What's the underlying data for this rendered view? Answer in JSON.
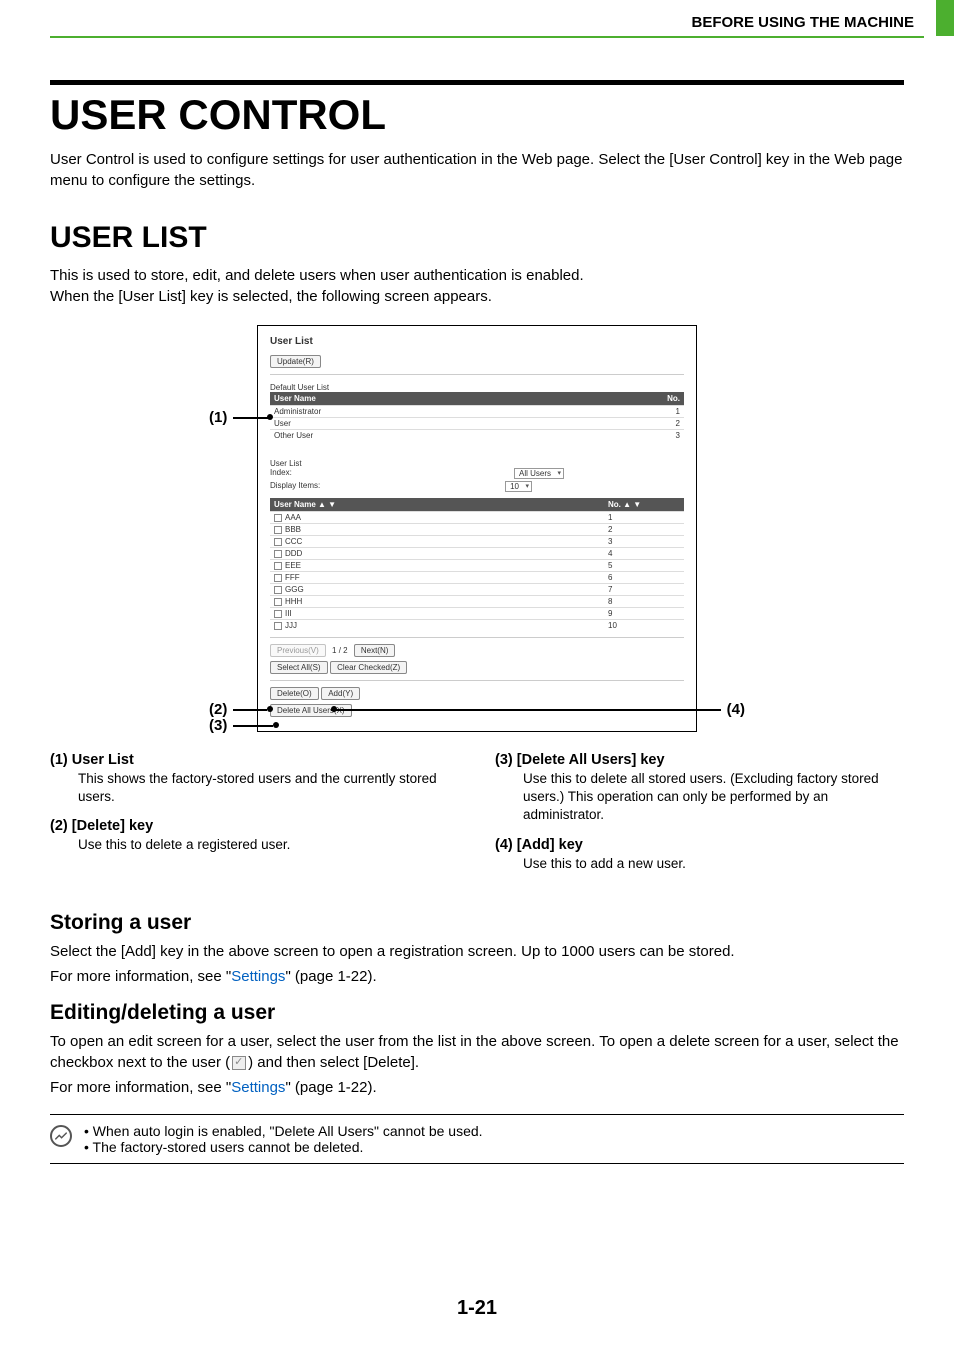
{
  "breadcrumb": "BEFORE USING THE MACHINE",
  "title": "USER CONTROL",
  "intro": "User Control is used to configure settings for user authentication in the Web page. Select the [User Control] key in the Web page menu to configure the settings.",
  "subtitle": "USER LIST",
  "sub_intro": "This is used to store, edit, and delete users when user authentication is enabled.\nWhen the [User List] key is selected, the following screen appears.",
  "shot": {
    "panel_title": "User List",
    "update_btn": "Update(R)",
    "default_list_label": "Default User List",
    "col_user": "User Name",
    "col_no": "No.",
    "defaults": [
      {
        "name": "Administrator",
        "no": "1"
      },
      {
        "name": "User",
        "no": "2"
      },
      {
        "name": "Other User",
        "no": "3"
      }
    ],
    "user_list_label": "User List",
    "index_label": "Index:",
    "index_value": "All Users",
    "display_items_label": "Display Items:",
    "display_items_value": "10",
    "col2_user": "User Name ▲ ▼",
    "col2_no": "No. ▲ ▼",
    "rows": [
      {
        "name": "AAA",
        "no": "1"
      },
      {
        "name": "BBB",
        "no": "2"
      },
      {
        "name": "CCC",
        "no": "3"
      },
      {
        "name": "DDD",
        "no": "4"
      },
      {
        "name": "EEE",
        "no": "5"
      },
      {
        "name": "FFF",
        "no": "6"
      },
      {
        "name": "GGG",
        "no": "7"
      },
      {
        "name": "HHH",
        "no": "8"
      },
      {
        "name": "III",
        "no": "9"
      },
      {
        "name": "JJJ",
        "no": "10"
      }
    ],
    "prev_btn": "Previous(V)",
    "page_ind": "1 / 2",
    "next_btn": "Next(N)",
    "select_all_btn": "Select All(S)",
    "clear_checked_btn": "Clear Checked(Z)",
    "delete_btn": "Delete(O)",
    "add_btn": "Add(Y)",
    "delete_all_btn": "Delete All Users(X)"
  },
  "callouts": {
    "c1": "(1)",
    "c2": "(2)",
    "c3": "(3)",
    "c4": "(4)"
  },
  "desc": {
    "d1": {
      "num": "(1)",
      "head": "User List",
      "body": "This shows the factory-stored users and the currently stored users."
    },
    "d2": {
      "num": "(2)",
      "head": "[Delete] key",
      "body": "Use this to delete a registered user."
    },
    "d3": {
      "num": "(3)",
      "head": "[Delete All Users] key",
      "body": "Use this to delete all stored users. (Excluding factory stored users.) This operation can only be performed by an administrator."
    },
    "d4": {
      "num": "(4)",
      "head": "[Add] key",
      "body": "Use this to add a new user."
    }
  },
  "storing_head": "Storing a user",
  "storing_body1": "Select the [Add] key in the above screen to open a registration screen. Up to 1000 users can be stored.",
  "storing_body2a": "For more information, see \"",
  "storing_link": "Settings",
  "storing_body2b": "\" (page 1-22).",
  "edit_head": "Editing/deleting a user",
  "edit_body1": "To open an edit screen for a user, select the user from the list in the above screen. To open a delete screen for a user, select the checkbox next to the user (",
  "edit_body1b": ") and then select [Delete].",
  "edit_body2a": "For more information, see \"",
  "edit_link": "Settings",
  "edit_body2b": "\" (page 1-22).",
  "note1": "When auto login is enabled, \"Delete All Users\" cannot be used.",
  "note2": "The factory-stored users cannot be deleted.",
  "page_number": "1-21"
}
